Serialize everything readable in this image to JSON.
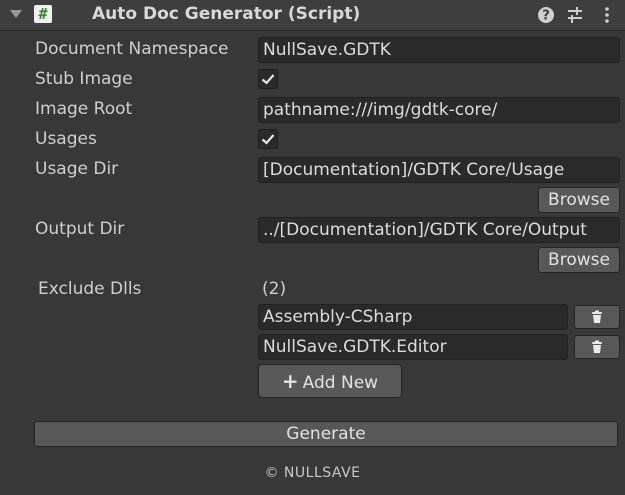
{
  "header": {
    "title": "Auto Doc Generator (Script)",
    "icons": [
      "foldout-arrow-icon",
      "script-icon",
      "help-icon",
      "presets-icon",
      "more-icon"
    ]
  },
  "fields": {
    "document_namespace": {
      "label": "Document Namespace",
      "value": "NullSave.GDTK"
    },
    "stub_image": {
      "label": "Stub Image",
      "checked": true
    },
    "image_root": {
      "label": "Image Root",
      "value": "pathname:///img/gdtk-core/"
    },
    "usages": {
      "label": "Usages",
      "checked": true
    },
    "usage_dir": {
      "label": "Usage Dir",
      "value": "[Documentation]/GDTK Core/Usage",
      "browse_label": "Browse"
    },
    "output_dir": {
      "label": "Output Dir",
      "value": "../[Documentation]/GDTK Core/Output",
      "browse_label": "Browse"
    }
  },
  "exclude_dlls": {
    "label": "Exclude Dlls",
    "count": "(2)",
    "items": [
      "Assembly-CSharp",
      "NullSave.GDTK.Editor"
    ],
    "add_label": "Add New"
  },
  "generate_label": "Generate",
  "footer": "© NULLSAVE"
}
